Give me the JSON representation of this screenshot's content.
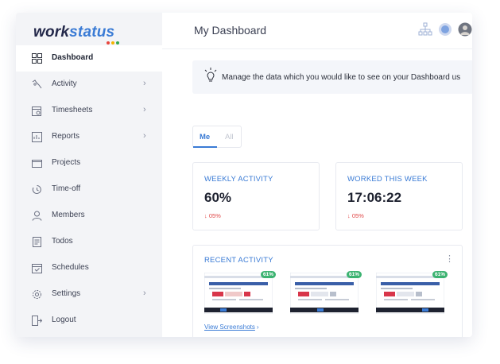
{
  "brand": {
    "logo_part1": "work",
    "logo_part2": "status",
    "dot_colors": [
      "#e8453c",
      "#f4b400",
      "#34a853"
    ],
    "accent": "#3a7bd5"
  },
  "sidebar": {
    "items": [
      {
        "label": "Dashboard",
        "icon": "grid-icon",
        "active": true,
        "chevron": false
      },
      {
        "label": "Activity",
        "icon": "activity-icon",
        "active": false,
        "chevron": true
      },
      {
        "label": "Timesheets",
        "icon": "timesheet-icon",
        "active": false,
        "chevron": true
      },
      {
        "label": "Reports",
        "icon": "report-icon",
        "active": false,
        "chevron": true
      },
      {
        "label": "Projects",
        "icon": "folder-icon",
        "active": false,
        "chevron": false
      },
      {
        "label": "Time-off",
        "icon": "time-off-icon",
        "active": false,
        "chevron": false
      },
      {
        "label": "Members",
        "icon": "user-icon",
        "active": false,
        "chevron": false
      },
      {
        "label": "Todos",
        "icon": "todo-icon",
        "active": false,
        "chevron": false
      },
      {
        "label": "Schedules",
        "icon": "calendar-icon",
        "active": false,
        "chevron": false
      },
      {
        "label": "Settings",
        "icon": "gear-icon",
        "active": false,
        "chevron": true
      },
      {
        "label": "Logout",
        "icon": "logout-icon",
        "active": false,
        "chevron": false
      }
    ]
  },
  "header": {
    "title": "My Dashboard",
    "icons": [
      "org-chart-icon",
      "status-circle-icon",
      "avatar"
    ]
  },
  "banner": {
    "text": "Manage the data which you would like to see on your Dashboard us"
  },
  "toggle": {
    "me": "Me",
    "all": "All"
  },
  "cards": {
    "weekly_activity": {
      "title": "WEEKLY ACTIVITY",
      "value": "60%",
      "delta": "↓ 05%"
    },
    "worked_this_week": {
      "title": "WORKED THIS WEEK",
      "value": "17:06:22",
      "delta": "↓ 05%"
    }
  },
  "recent": {
    "title": "RECENT ACTIVITY",
    "shots": [
      {
        "badge": "61%"
      },
      {
        "badge": "61%"
      },
      {
        "badge": "61%"
      }
    ],
    "view_link": "View Screenshots",
    "view_arrow": "›"
  }
}
